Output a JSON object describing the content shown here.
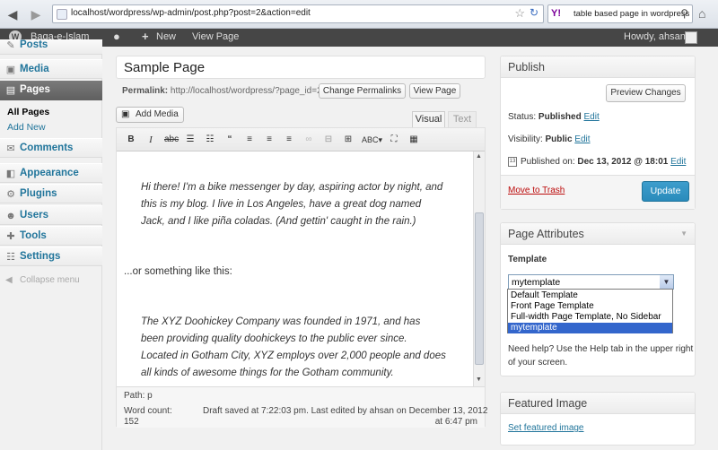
{
  "browser": {
    "url": "localhost/wordpress/wp-admin/post.php?post=2&action=edit",
    "search_query": "table based page in wordpress",
    "search_engine_logo": "Y!"
  },
  "admin_bar": {
    "site_name": "Baqa-e-Islam",
    "new_label": "New",
    "view_page_label": "View Page",
    "greeting": "Howdy, ahsan"
  },
  "sidebar": {
    "items": [
      {
        "label": "Posts",
        "icon": "pin-icon"
      },
      {
        "label": "Media",
        "icon": "media-icon"
      },
      {
        "label": "Pages",
        "icon": "pages-icon"
      },
      {
        "label": "Comments",
        "icon": "comment-icon"
      },
      {
        "label": "Appearance",
        "icon": "appearance-icon"
      },
      {
        "label": "Plugins",
        "icon": "plugin-icon"
      },
      {
        "label": "Users",
        "icon": "users-icon"
      },
      {
        "label": "Tools",
        "icon": "tools-icon"
      },
      {
        "label": "Settings",
        "icon": "settings-icon"
      }
    ],
    "submenu": [
      "All Pages",
      "Add New"
    ],
    "collapse_label": "Collapse menu"
  },
  "editor": {
    "title": "Sample Page",
    "permalink_label": "Permalink:",
    "permalink_url": "http://localhost/wordpress/?page_id=2",
    "change_permalinks": "Change Permalinks",
    "view_page": "View Page",
    "add_media": "Add Media",
    "tab_visual": "Visual",
    "tab_text": "Text",
    "paragraph1": "Hi there! I'm a bike messenger by day, aspiring actor by night, and this is my blog. I live in Los Angeles, have a great dog named Jack, and I like piña coladas. (And gettin' caught in the rain.)",
    "paragraph2": "...or something like this:",
    "paragraph3": "The XYZ Doohickey Company was founded in 1971, and has been providing quality doohickeys to the public ever since. Located in Gotham City, XYZ employs over 2,000 people and does all kinds of awesome things for the Gotham community.",
    "path": "Path: p",
    "word_count_label": "Word count:",
    "word_count": "152",
    "draft_status_1": "Draft saved at 7:22:03 pm. Last edited by ahsan on December 13, 2012",
    "draft_status_2": "at 6:47 pm"
  },
  "publish": {
    "heading": "Publish",
    "preview_button": "Preview Changes",
    "status_label": "Status:",
    "status_value": "Published",
    "visibility_label": "Visibility:",
    "visibility_value": "Public",
    "published_on_label": "Published on:",
    "published_on_value": "Dec 13, 2012 @ 18:01",
    "edit_link": "Edit",
    "trash_link": "Move to Trash",
    "update_button": "Update"
  },
  "page_attributes": {
    "heading": "Page Attributes",
    "template_label": "Template",
    "selected_template": "mytemplate",
    "options": [
      "Default Template",
      "Front Page Template",
      "Full-width Page Template, No Sidebar",
      "mytemplate"
    ],
    "help_text_1": "Need help? Use the Help tab in the upper right",
    "help_text_2": "of your screen."
  },
  "featured_image": {
    "heading": "Featured Image",
    "set_link": "Set featured image"
  },
  "colors": {
    "link": "#21759b",
    "update_button": "#2a8bbb",
    "trash": "#bc0b0b",
    "admin_bar": "#464646",
    "dropdown_highlight": "#3366cc"
  }
}
